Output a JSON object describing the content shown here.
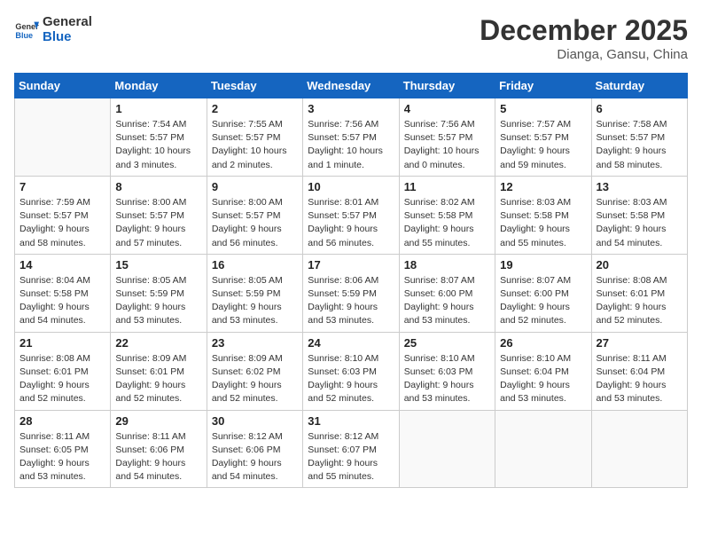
{
  "header": {
    "logo_line1": "General",
    "logo_line2": "Blue",
    "month": "December 2025",
    "location": "Dianga, Gansu, China"
  },
  "days_of_week": [
    "Sunday",
    "Monday",
    "Tuesday",
    "Wednesday",
    "Thursday",
    "Friday",
    "Saturday"
  ],
  "weeks": [
    [
      {
        "day": "",
        "info": ""
      },
      {
        "day": "1",
        "info": "Sunrise: 7:54 AM\nSunset: 5:57 PM\nDaylight: 10 hours\nand 3 minutes."
      },
      {
        "day": "2",
        "info": "Sunrise: 7:55 AM\nSunset: 5:57 PM\nDaylight: 10 hours\nand 2 minutes."
      },
      {
        "day": "3",
        "info": "Sunrise: 7:56 AM\nSunset: 5:57 PM\nDaylight: 10 hours\nand 1 minute."
      },
      {
        "day": "4",
        "info": "Sunrise: 7:56 AM\nSunset: 5:57 PM\nDaylight: 10 hours\nand 0 minutes."
      },
      {
        "day": "5",
        "info": "Sunrise: 7:57 AM\nSunset: 5:57 PM\nDaylight: 9 hours\nand 59 minutes."
      },
      {
        "day": "6",
        "info": "Sunrise: 7:58 AM\nSunset: 5:57 PM\nDaylight: 9 hours\nand 58 minutes."
      }
    ],
    [
      {
        "day": "7",
        "info": "Sunrise: 7:59 AM\nSunset: 5:57 PM\nDaylight: 9 hours\nand 58 minutes."
      },
      {
        "day": "8",
        "info": "Sunrise: 8:00 AM\nSunset: 5:57 PM\nDaylight: 9 hours\nand 57 minutes."
      },
      {
        "day": "9",
        "info": "Sunrise: 8:00 AM\nSunset: 5:57 PM\nDaylight: 9 hours\nand 56 minutes."
      },
      {
        "day": "10",
        "info": "Sunrise: 8:01 AM\nSunset: 5:57 PM\nDaylight: 9 hours\nand 56 minutes."
      },
      {
        "day": "11",
        "info": "Sunrise: 8:02 AM\nSunset: 5:58 PM\nDaylight: 9 hours\nand 55 minutes."
      },
      {
        "day": "12",
        "info": "Sunrise: 8:03 AM\nSunset: 5:58 PM\nDaylight: 9 hours\nand 55 minutes."
      },
      {
        "day": "13",
        "info": "Sunrise: 8:03 AM\nSunset: 5:58 PM\nDaylight: 9 hours\nand 54 minutes."
      }
    ],
    [
      {
        "day": "14",
        "info": "Sunrise: 8:04 AM\nSunset: 5:58 PM\nDaylight: 9 hours\nand 54 minutes."
      },
      {
        "day": "15",
        "info": "Sunrise: 8:05 AM\nSunset: 5:59 PM\nDaylight: 9 hours\nand 53 minutes."
      },
      {
        "day": "16",
        "info": "Sunrise: 8:05 AM\nSunset: 5:59 PM\nDaylight: 9 hours\nand 53 minutes."
      },
      {
        "day": "17",
        "info": "Sunrise: 8:06 AM\nSunset: 5:59 PM\nDaylight: 9 hours\nand 53 minutes."
      },
      {
        "day": "18",
        "info": "Sunrise: 8:07 AM\nSunset: 6:00 PM\nDaylight: 9 hours\nand 53 minutes."
      },
      {
        "day": "19",
        "info": "Sunrise: 8:07 AM\nSunset: 6:00 PM\nDaylight: 9 hours\nand 52 minutes."
      },
      {
        "day": "20",
        "info": "Sunrise: 8:08 AM\nSunset: 6:01 PM\nDaylight: 9 hours\nand 52 minutes."
      }
    ],
    [
      {
        "day": "21",
        "info": "Sunrise: 8:08 AM\nSunset: 6:01 PM\nDaylight: 9 hours\nand 52 minutes."
      },
      {
        "day": "22",
        "info": "Sunrise: 8:09 AM\nSunset: 6:01 PM\nDaylight: 9 hours\nand 52 minutes."
      },
      {
        "day": "23",
        "info": "Sunrise: 8:09 AM\nSunset: 6:02 PM\nDaylight: 9 hours\nand 52 minutes."
      },
      {
        "day": "24",
        "info": "Sunrise: 8:10 AM\nSunset: 6:03 PM\nDaylight: 9 hours\nand 52 minutes."
      },
      {
        "day": "25",
        "info": "Sunrise: 8:10 AM\nSunset: 6:03 PM\nDaylight: 9 hours\nand 53 minutes."
      },
      {
        "day": "26",
        "info": "Sunrise: 8:10 AM\nSunset: 6:04 PM\nDaylight: 9 hours\nand 53 minutes."
      },
      {
        "day": "27",
        "info": "Sunrise: 8:11 AM\nSunset: 6:04 PM\nDaylight: 9 hours\nand 53 minutes."
      }
    ],
    [
      {
        "day": "28",
        "info": "Sunrise: 8:11 AM\nSunset: 6:05 PM\nDaylight: 9 hours\nand 53 minutes."
      },
      {
        "day": "29",
        "info": "Sunrise: 8:11 AM\nSunset: 6:06 PM\nDaylight: 9 hours\nand 54 minutes."
      },
      {
        "day": "30",
        "info": "Sunrise: 8:12 AM\nSunset: 6:06 PM\nDaylight: 9 hours\nand 54 minutes."
      },
      {
        "day": "31",
        "info": "Sunrise: 8:12 AM\nSunset: 6:07 PM\nDaylight: 9 hours\nand 55 minutes."
      },
      {
        "day": "",
        "info": ""
      },
      {
        "day": "",
        "info": ""
      },
      {
        "day": "",
        "info": ""
      }
    ]
  ]
}
